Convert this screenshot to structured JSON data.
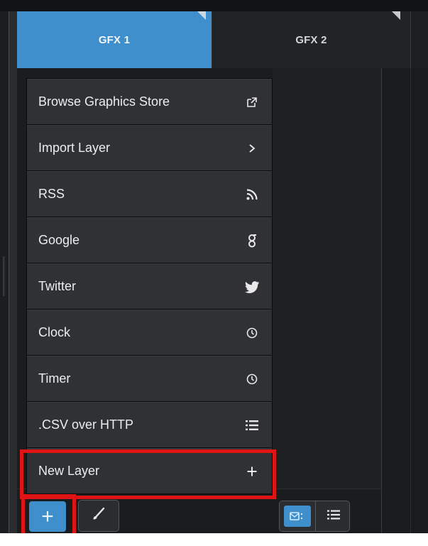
{
  "tabs": [
    {
      "label": "GFX 1",
      "active": true
    },
    {
      "label": "GFX 2",
      "active": false
    }
  ],
  "menu": {
    "items": [
      {
        "label": "Browse Graphics Store",
        "icon": "external-link-icon"
      },
      {
        "label": "Import Layer",
        "icon": "chevron-right-icon"
      },
      {
        "label": "RSS",
        "icon": "rss-icon"
      },
      {
        "label": "Google",
        "icon": "google-icon"
      },
      {
        "label": "Twitter",
        "icon": "twitter-icon"
      },
      {
        "label": "Clock",
        "icon": "clock-icon"
      },
      {
        "label": "Timer",
        "icon": "timer-icon"
      },
      {
        "label": ".CSV over HTTP",
        "icon": "list-icon"
      },
      {
        "label": "New Layer",
        "icon": "plus-icon"
      }
    ]
  },
  "bottom": {
    "add_label": "+",
    "brush_icon": "brush-icon",
    "view_grid_icon": "grid-view-icon",
    "view_list_icon": "list-view-icon"
  },
  "colors": {
    "accent": "#3e8fcb",
    "highlight": "#e01414",
    "menu_bg": "#303134",
    "panel_bg": "#1b1c1e"
  }
}
